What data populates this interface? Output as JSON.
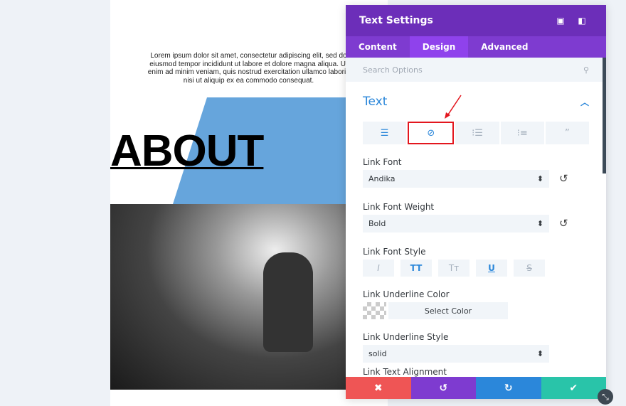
{
  "page": {
    "lorem": "Lorem ipsum dolor sit amet, consectetur adipiscing elit, sed do eiusmod tempor incididunt ut labore et dolore magna aliqua. Ut enim ad minim veniam, quis nostrud exercitation ullamco laboris nisi ut aliquip ex ea commodo consequat.",
    "heading": "ABOUT"
  },
  "panel": {
    "title": "Text Settings",
    "tabs": [
      {
        "label": "Content"
      },
      {
        "label": "Design"
      },
      {
        "label": "Advanced"
      }
    ],
    "active_tab": "Design",
    "search_placeholder": "Search Options",
    "section": "Text",
    "text_tabs": [
      "align-left-icon",
      "link-icon",
      "list-icon",
      "ordered-list-icon",
      "quote-icon"
    ],
    "link_font": {
      "label": "Link Font",
      "value": "Andika"
    },
    "link_font_weight": {
      "label": "Link Font Weight",
      "value": "Bold"
    },
    "link_font_style": {
      "label": "Link Font Style",
      "buttons": [
        "I",
        "TT",
        "Tт",
        "U",
        "S"
      ],
      "active": [
        "TT",
        "U"
      ]
    },
    "link_underline_color": {
      "label": "Link Underline Color",
      "button": "Select Color"
    },
    "link_underline_style": {
      "label": "Link Underline Style",
      "value": "solid"
    },
    "link_text_alignment": {
      "label": "Link Text Alignment"
    }
  },
  "colors": {
    "header": "#6c2eb9",
    "tabs": "#7e3bd0",
    "accent": "#2b87da",
    "cancel": "#ef5555",
    "undo": "#7e3bd0",
    "redo": "#2b87da",
    "save": "#29c4a9"
  }
}
